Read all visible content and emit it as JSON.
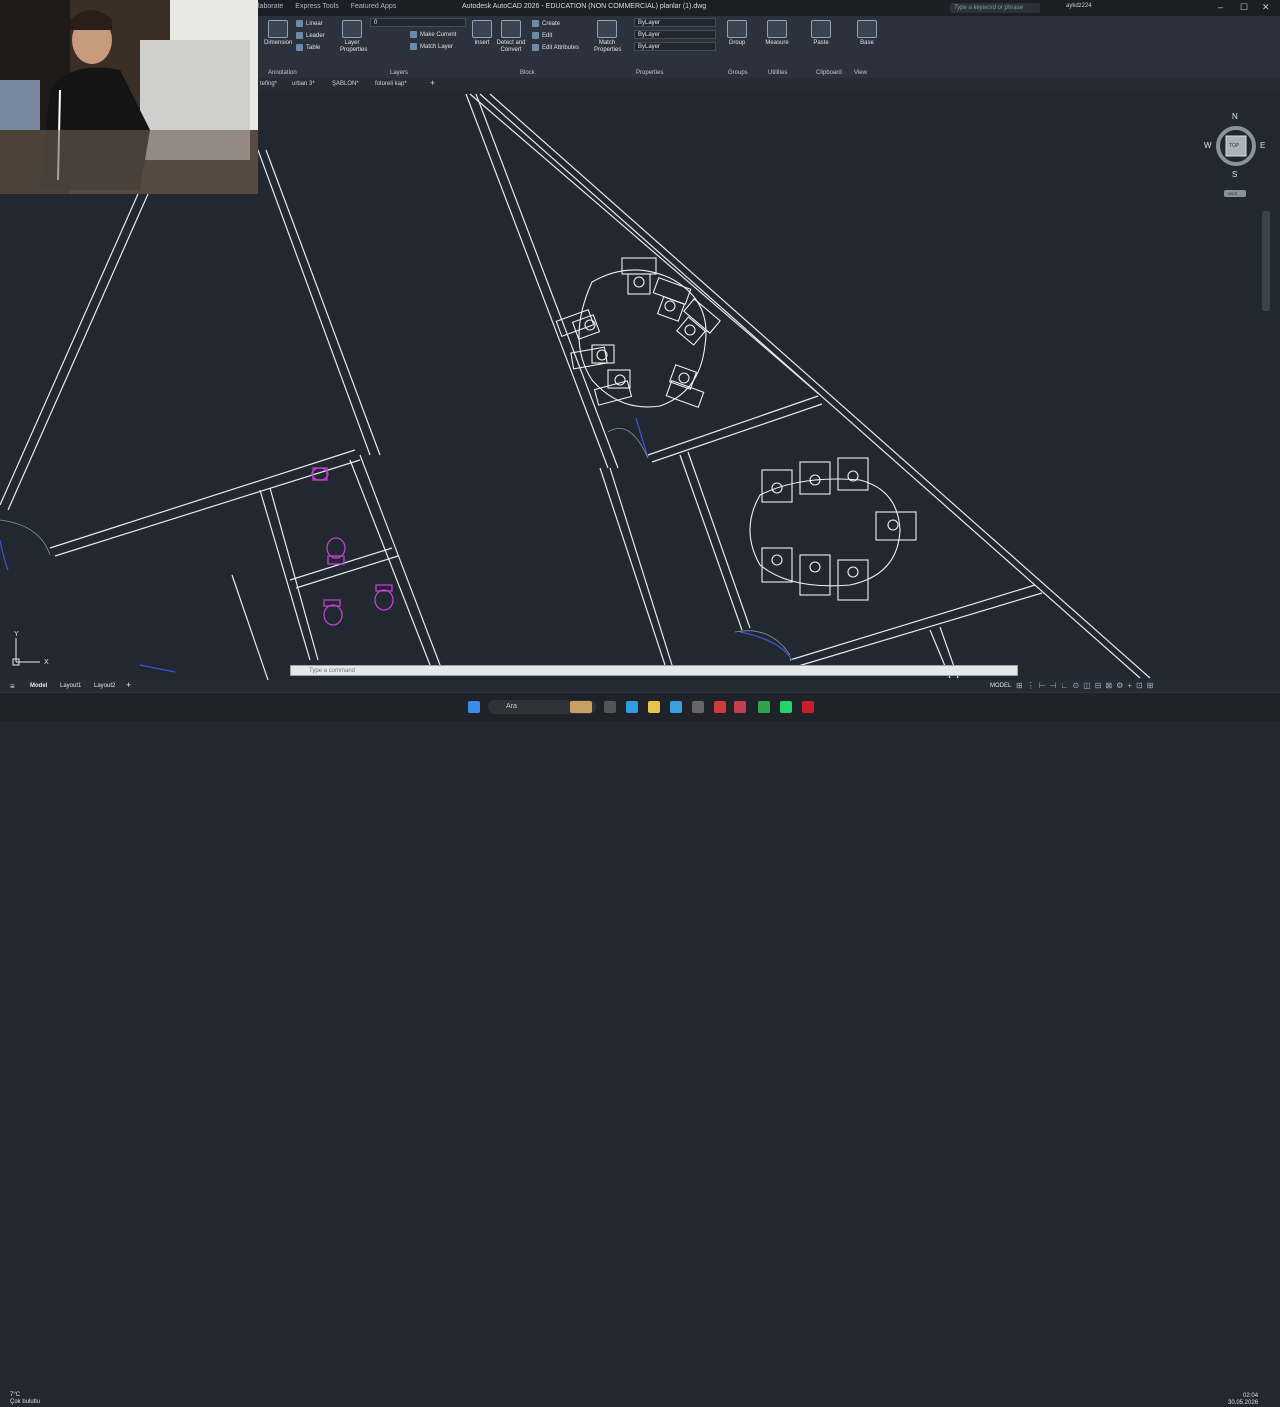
{
  "app": {
    "title": "Autodesk AutoCAD 2026 - EDUCATION (NON COMMERCIAL)   planlar (1).dwg",
    "menu_tabs": [
      "laborate",
      "Express Tools",
      "Featured Apps"
    ],
    "search_placeholder": "Type a keyword or phrase",
    "user": "aykdz224"
  },
  "ribbon": {
    "annotation": {
      "dimension": "Dimension",
      "linear": "Linear",
      "leader": "Leader",
      "table": "Table",
      "title": "Annotation"
    },
    "layers": {
      "layer_properties": "Layer Properties",
      "make_current": "Make Current",
      "match_layer": "Match Layer",
      "layer_value": "0",
      "title": "Layers"
    },
    "block": {
      "insert": "Insert",
      "detect_convert": "Detect and Convert",
      "create": "Create",
      "edit": "Edit",
      "edit_attributes": "Edit Attributes",
      "title": "Block"
    },
    "properties": {
      "match_properties": "Match Properties",
      "color": "ByLayer",
      "linetype": "ByLayer",
      "lineweight": "ByLayer",
      "title": "Properties"
    },
    "groups": {
      "group": "Group",
      "title": "Groups"
    },
    "utilities": {
      "measure": "Measure",
      "title": "Utilities"
    },
    "clipboard": {
      "paste": "Paste",
      "title": "Clipboard"
    },
    "view": {
      "base": "Base",
      "title": "View"
    }
  },
  "file_tabs": [
    "tefing*",
    "urban 3*",
    "ŞABLON*",
    "fotoreli kap*"
  ],
  "navcube": {
    "n": "N",
    "s": "S",
    "e": "E",
    "w": "W",
    "top": "TOP",
    "wcs": "WCS"
  },
  "command_line": {
    "placeholder": "Type a command"
  },
  "layout_tabs": [
    "Model",
    "Layout1",
    "Layout2"
  ],
  "status": {
    "model": "MODEL"
  },
  "taskbar": {
    "weather_temp": "7°C",
    "weather_desc": "Çok bulutlu",
    "search": "Ara",
    "time": "02:04",
    "date": "30.05.2026"
  },
  "colors": {
    "background": "#212830",
    "ribbon": "#2b323b",
    "line": "#e6e9ee",
    "fixture": "#c23fd0",
    "door": "#3b55d6"
  }
}
